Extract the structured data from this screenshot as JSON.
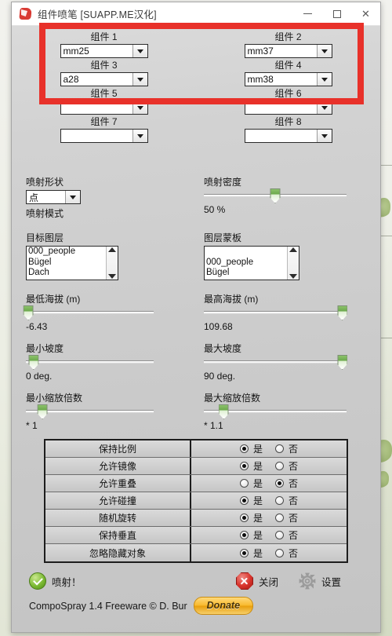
{
  "window": {
    "title": "组件喷笔 [SUAPP.ME汉化]",
    "icon": "sketchup-app-icon",
    "controls": {
      "minimize": "–",
      "maximize": "□",
      "close": "✕"
    }
  },
  "components": [
    {
      "label": "组件 1",
      "value": "mm25"
    },
    {
      "label": "组件 2",
      "value": "mm37"
    },
    {
      "label": "组件 3",
      "value": "a28"
    },
    {
      "label": "组件 4",
      "value": "mm38"
    },
    {
      "label": "组件 5",
      "value": ""
    },
    {
      "label": "组件 6",
      "value": ""
    },
    {
      "label": "组件 7",
      "value": ""
    },
    {
      "label": "组件 8",
      "value": ""
    }
  ],
  "spray": {
    "shape_label": "喷射形状",
    "shape_value": "点",
    "mode_label": "喷射模式",
    "density_label": "喷射密度",
    "density_value": "50 %",
    "density_pct": 50
  },
  "layers": {
    "target_label": "目标图层",
    "target_items": [
      "000_people",
      "Bügel",
      "Dach"
    ],
    "mask_label": "图层蒙板",
    "mask_items": [
      "",
      "000_people",
      "Bügel"
    ]
  },
  "ranges": [
    {
      "label": "最低海拔 (m)",
      "value": "-6.43",
      "pct": 2
    },
    {
      "label": "最高海拔 (m)",
      "value": "109.68",
      "pct": 97
    },
    {
      "label": "最小坡度",
      "value": "0 deg.",
      "pct": 6
    },
    {
      "label": "最大坡度",
      "value": "90 deg.",
      "pct": 97
    },
    {
      "label": "最小缩放倍数",
      "value": "* 1",
      "pct": 13
    },
    {
      "label": "最大缩放倍数",
      "value": "* 1.1",
      "pct": 14
    }
  ],
  "options": {
    "yes_label": "是",
    "no_label": "否",
    "rows": [
      {
        "name": "保持比例",
        "selected": "yes"
      },
      {
        "name": "允许镜像",
        "selected": "yes"
      },
      {
        "name": "允许重叠",
        "selected": "no"
      },
      {
        "name": "允许碰撞",
        "selected": "yes"
      },
      {
        "name": "随机旋转",
        "selected": "yes"
      },
      {
        "name": "保持垂直",
        "selected": "yes"
      },
      {
        "name": "忽略隐藏对象",
        "selected": "yes"
      }
    ]
  },
  "footer": {
    "spray_button": "喷射！",
    "close_button": "关闭",
    "settings_button": "设置",
    "copyright": "CompoSpray 1.4 Freeware © D. Bur",
    "donate_button": "Donate"
  },
  "annotation": {
    "color": "#e8312a",
    "shape": "rectangle-highlight"
  }
}
